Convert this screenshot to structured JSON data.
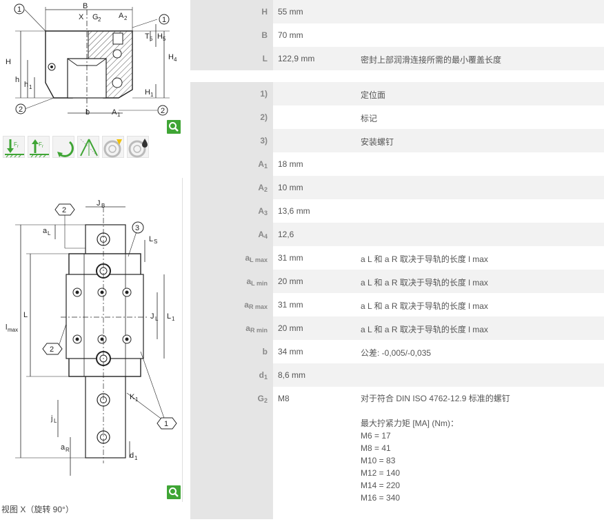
{
  "caption": "视图 X（旋转 90°）",
  "drawing1": {
    "labels": [
      "B",
      "X",
      "G",
      "2",
      "A",
      "2",
      "H",
      "h",
      "h",
      "1",
      "b",
      "A",
      "1",
      "T",
      "5",
      "H",
      "5",
      "H",
      "4",
      "H",
      "1"
    ],
    "callouts": [
      "1",
      "2",
      "2",
      "1"
    ]
  },
  "drawing2": {
    "labels": [
      "J",
      "B",
      "a",
      "L",
      "L",
      "S",
      "l",
      "max",
      "L",
      "J",
      "L",
      "L",
      "1",
      "K",
      "1",
      "j",
      "L",
      "a",
      "R",
      "d",
      "1"
    ],
    "callouts": [
      "2",
      "3",
      "2",
      "1"
    ]
  },
  "icons": [
    {
      "name": "radial-load-down-icon",
      "text": "Fr"
    },
    {
      "name": "radial-load-up-icon",
      "text": "Fr"
    },
    {
      "name": "moment-load-icon",
      "text": ""
    },
    {
      "name": "rigidity-icon",
      "text": ""
    },
    {
      "name": "speed-icon",
      "text": ""
    },
    {
      "name": "lubrication-icon",
      "text": ""
    }
  ],
  "table1": [
    {
      "key": "H",
      "sub": "",
      "value": "55  mm",
      "note": ""
    },
    {
      "key": "B",
      "sub": "",
      "value": "70  mm",
      "note": ""
    },
    {
      "key": "L",
      "sub": "",
      "value": "122,9  mm",
      "note": "密封上部润滑连接所需的最小覆盖长度"
    }
  ],
  "table2": [
    {
      "key": "1)",
      "sub": "",
      "value": "",
      "note": "定位面"
    },
    {
      "key": "2)",
      "sub": "",
      "value": "",
      "note": "标记"
    },
    {
      "key": "3)",
      "sub": "",
      "value": "",
      "note": "安装螺钉"
    },
    {
      "key": "A",
      "sub": "1",
      "value": "18  mm",
      "note": ""
    },
    {
      "key": "A",
      "sub": "2",
      "value": "10  mm",
      "note": ""
    },
    {
      "key": "A",
      "sub": "3",
      "value": "13,6  mm",
      "note": ""
    },
    {
      "key": "A",
      "sub": "4",
      "value": "12,6",
      "note": ""
    },
    {
      "key": "a",
      "sub": "L max",
      "value": "31  mm",
      "note": "a L 和 a R 取决于导轨的长度 l max"
    },
    {
      "key": "a",
      "sub": "L min",
      "value": "20  mm",
      "note": "a L 和 a R 取决于导轨的长度 l max"
    },
    {
      "key": "a",
      "sub": "R max",
      "value": "31  mm",
      "note": "a L 和 a R 取决于导轨的长度 l max"
    },
    {
      "key": "a",
      "sub": "R min",
      "value": "20  mm",
      "note": "a L 和 a R 取决于导轨的长度 l max"
    },
    {
      "key": "b",
      "sub": "",
      "value": "34  mm",
      "note": "公差: -0,005/-0,035"
    },
    {
      "key": "d",
      "sub": "1",
      "value": "8,6  mm",
      "note": ""
    }
  ],
  "g2": {
    "key": "G",
    "sub": "2",
    "value": "M8",
    "lines": [
      "对于符合 DIN ISO 4762-12.9 标准的螺钉",
      "",
      "最大拧紧力矩 [MA] (Nm)：",
      "M6 = 17",
      "M8 = 41",
      "M10 = 83",
      "M12 = 140",
      "M14 = 220",
      "M16 = 340"
    ]
  }
}
